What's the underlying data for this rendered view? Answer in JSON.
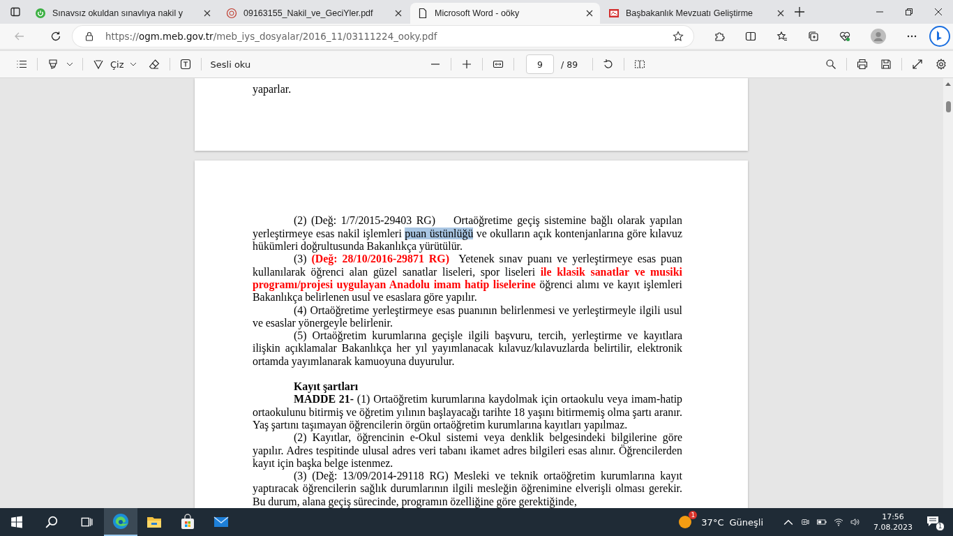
{
  "tabs": [
    {
      "kind": "power",
      "title": "Sınavsız okuldan sınavlıya nakil y",
      "selected": false
    },
    {
      "kind": "emblem",
      "title": "09163155_Nakil_ve_GeciYler.pdf",
      "selected": false
    },
    {
      "kind": "document",
      "title": "Microsoft Word - oöky",
      "selected": true
    },
    {
      "kind": "pdf",
      "title": "Başbakanlık Mevzuatı Geliştirme",
      "selected": false
    }
  ],
  "address_bar": {
    "back_enabled": false,
    "scheme": "https://",
    "host": "ogm.meb.gov.tr",
    "path": "/meb_iys_dosyalar/2016_11/03111224_ooky.pdf"
  },
  "pdf_toolbar": {
    "draw_label": "Çiz",
    "read_aloud_label": "Sesli oku",
    "page": "9",
    "page_total": "/ 89"
  },
  "document": {
    "previous_page_tail": "yaparlar.",
    "blocks": [
      {
        "kind": "paragraph",
        "segments": [
          {
            "kind": "plain",
            "text": "(2) (Değ: 1/7/2015-29403 RG)    Ortaöğretime geçiş sistemine bağlı olarak yapılan yerleştirmeye esas nakil işlemleri "
          },
          {
            "kind": "highlighted",
            "text": "puan üstünlüğü"
          },
          {
            "kind": "plain",
            "text": " ve okulların açık kontenjanlarına göre kılavuz hükümleri doğrultusunda Bakanlıkça yürütülür."
          }
        ]
      },
      {
        "kind": "paragraph",
        "segments": [
          {
            "kind": "plain",
            "text": "(3) "
          },
          {
            "kind": "amendment",
            "text": "(Değ: 28/10/2016-29871 RG)"
          },
          {
            "kind": "plain",
            "text": "  Yetenek sınav puanı ve yerleştirmeye esas puan kullanılarak öğrenci alan güzel sanatlar liseleri, spor liseleri "
          },
          {
            "kind": "amendment",
            "text": "ile klasik sanatlar ve musiki programı/projesi uygulayan Anadolu imam hatip liselerine"
          },
          {
            "kind": "plain",
            "text": " öğrenci alımı ve kayıt işlemleri Bakanlıkça belirlenen usul ve esaslara göre yapılır."
          }
        ]
      },
      {
        "kind": "paragraph",
        "segments": [
          {
            "kind": "plain",
            "text": "(4) Ortaöğretime yerleştirmeye esas puanının belirlenmesi ve yerleştirmeyle ilgili usul ve esaslar yönergeyle belirlenir."
          }
        ]
      },
      {
        "kind": "paragraph",
        "segments": [
          {
            "kind": "plain",
            "text": "(5) Ortaöğretim kurumlarına geçişle ilgili başvuru, tercih, yerleştirme ve kayıtlara ilişkin açıklamalar Bakanlıkça her yıl yayımlanacak kılavuz/kılavuzlarda belirtilir, elektronik ortamda yayımlanarak kamuoyuna duyurulur."
          }
        ]
      },
      {
        "kind": "heading",
        "text": "Kayıt şartları"
      },
      {
        "kind": "paragraph",
        "segments": [
          {
            "kind": "article",
            "text": "MADDE 21-"
          },
          {
            "kind": "plain",
            "text": " (1) Ortaöğretim kurumlarına kaydolmak için ortaokulu veya imam-hatip ortaokulunu bitirmiş ve öğretim yılının başlayacağı tarihte 18 yaşını bitirmemiş olma şartı aranır. Yaş şartını taşımayan öğrencilerin örgün ortaöğretim kurumlarına kayıtları yapılmaz."
          }
        ]
      },
      {
        "kind": "paragraph",
        "segments": [
          {
            "kind": "plain",
            "text": "(2) Kayıtlar, öğrencinin e-Okul sistemi veya denklik belgesindeki bilgilerine göre yapılır. Adres tespitinde ulusal adres veri tabanı ikamet adres bilgileri esas alınır. Öğrencilerden kayıt için başka belge istenmez."
          }
        ]
      },
      {
        "kind": "paragraph",
        "segments": [
          {
            "kind": "plain",
            "text": "(3) (Değ: 13/09/2014-29118 RG) Mesleki ve teknik ortaöğretim kurumlarına kayıt yaptıracak öğrencilerin sağlık durumlarının ilgili mesleğin öğrenimine elverişli olması gerekir. Bu durum, alana geçiş sürecinde, programın özelliğine göre gerektiğinde,"
          }
        ]
      }
    ]
  },
  "taskbar": {
    "apps": [
      {
        "kind": "edge",
        "active": true
      },
      {
        "kind": "explorer",
        "active": false
      },
      {
        "kind": "store",
        "active": false
      },
      {
        "kind": "mail",
        "active": false
      }
    ],
    "weather": {
      "badge": "1",
      "temperature": "37°C",
      "condition": "Güneşli"
    },
    "clock": {
      "time": "17:56",
      "date": "7.08.2023"
    },
    "notifications": {
      "count": "1"
    }
  }
}
